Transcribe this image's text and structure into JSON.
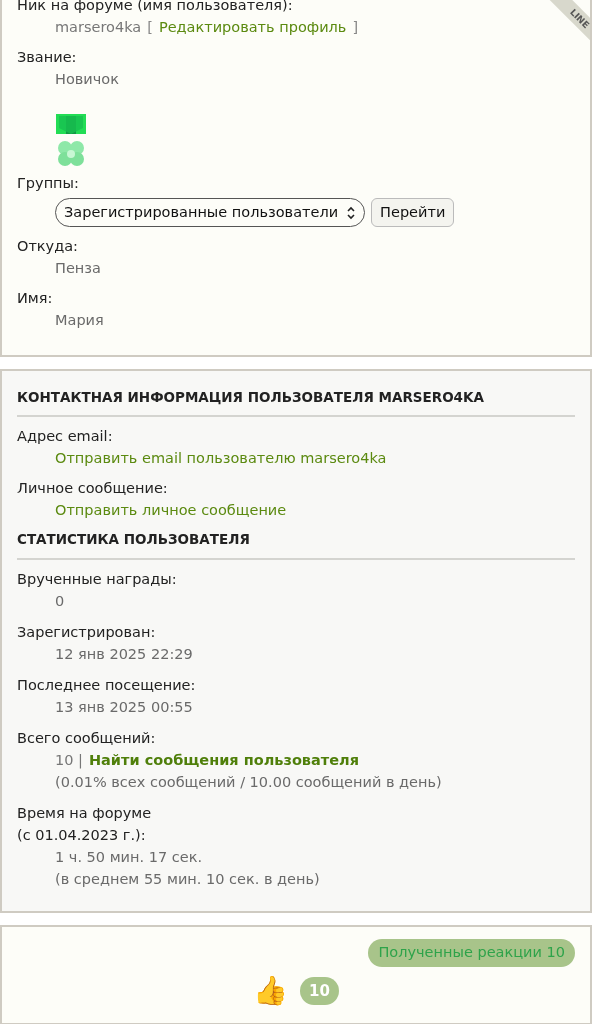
{
  "ribbon": "LINE",
  "profile": [
    {
      "kind": "nick",
      "label": "Ник на форуме (имя пользователя):",
      "value": "marsero4ka",
      "bracket_open": "[",
      "link": "Редактировать профиль",
      "bracket_close": "]"
    },
    {
      "kind": "text",
      "label": "Звание:",
      "value": "Новичок"
    },
    {
      "kind": "medal"
    },
    {
      "kind": "select",
      "label": "Группы:",
      "value": "Зарегистрированные пользователи",
      "button": "Перейти"
    },
    {
      "kind": "text",
      "label": "Откуда:",
      "value": "Пенза"
    },
    {
      "kind": "text",
      "label": "Имя:",
      "value": "Мария"
    }
  ],
  "contact": {
    "title": "КОНТАКТНАЯ ИНФОРМАЦИЯ ПОЛЬЗОВАТЕЛЯ MARSERO4KA",
    "rows": [
      {
        "label": "Адрес email:",
        "link": "Отправить email пользователю marsero4ka"
      },
      {
        "label": "Личное сообщение:",
        "link": "Отправить личное сообщение"
      }
    ]
  },
  "stats": {
    "title": "СТАТИСТИКА ПОЛЬЗОВАТЕЛЯ",
    "rows": [
      {
        "label": "Врученные награды:",
        "lines": [
          "0"
        ]
      },
      {
        "label": "Зарегистрирован:",
        "lines": [
          "12 янв 2025 22:29"
        ]
      },
      {
        "label": "Последнее посещение:",
        "lines": [
          "13 янв 2025 00:55"
        ]
      },
      {
        "label": "Всего сообщений:",
        "lines": [
          "10 |"
        ],
        "link": "Найти сообщения пользователя",
        "note": "(0.01% всех сообщений / 10.00 сообщений в день)"
      },
      {
        "label": "Время на форуме",
        "label2": "(с 01.04.2023 г.):",
        "lines": [
          "1 ч. 50 мин. 17 сек.",
          "(в среднем 55 мин. 10 сек. в день)"
        ]
      }
    ]
  },
  "reactions": {
    "button": "Полученные реакции 10",
    "items": [
      {
        "emoji": "👍",
        "count": "10"
      }
    ]
  }
}
